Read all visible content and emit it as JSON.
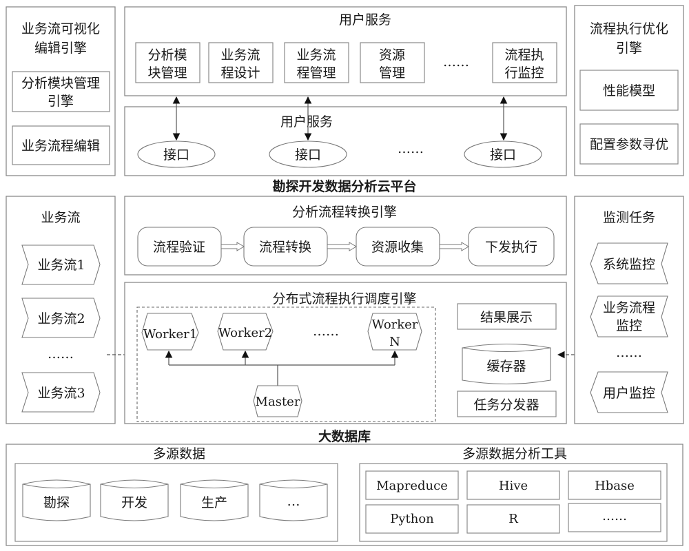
{
  "top_left_panel": {
    "title_line1": "业务流可视化",
    "title_line2": "编辑引擎",
    "item1_line1": "分析模块管理",
    "item1_line2": "引擎",
    "item2": "业务流程编辑"
  },
  "user_service_top": {
    "title": "用户服务",
    "modules": [
      {
        "line1": "分析模",
        "line2": "块管理"
      },
      {
        "line1": "业务流",
        "line2": "程设计"
      },
      {
        "line1": "业务流",
        "line2": "程管理"
      },
      {
        "line1": "资源",
        "line2": "管理"
      },
      {
        "line1": "流程执",
        "line2": "行监控"
      }
    ],
    "ellipsis": "……"
  },
  "user_service_bottom": {
    "title": "用户服务",
    "interfaces": [
      "接口",
      "接口",
      "接口"
    ],
    "ellipsis": "……"
  },
  "top_right_panel": {
    "title_line1": "流程执行优化",
    "title_line2": "引擎",
    "item1": "性能模型",
    "item2": "配置参数寻优"
  },
  "platform_title": "勘探开发数据分析云平台",
  "business_flow_panel": {
    "title": "业务流",
    "items": [
      "业务流1",
      "业务流2",
      "业务流3"
    ],
    "ellipsis": "……"
  },
  "conversion_engine": {
    "title": "分析流程转换引擎",
    "steps": [
      "流程验证",
      "流程转换",
      "资源收集",
      "下发执行"
    ]
  },
  "scheduling_engine": {
    "title": "分布式流程执行调度引擎",
    "workers": [
      "Worker1",
      "Worker2"
    ],
    "worker_n_line1": "Worker",
    "worker_n_line2": "N",
    "ellipsis": "……",
    "master": "Master",
    "result_display": "结果展示",
    "cache": "缓存器",
    "dispatcher": "任务分发器"
  },
  "monitoring_panel": {
    "title": "监测任务",
    "item1": "系统监控",
    "item2_line1": "业务流程",
    "item2_line2": "监控",
    "item3": "用户监控",
    "ellipsis": "……"
  },
  "database_title": "大数据库",
  "multi_source_data": {
    "title": "多源数据",
    "items": [
      "勘探",
      "开发",
      "生产",
      "…"
    ]
  },
  "analysis_tools": {
    "title": "多源数据分析工具",
    "items": [
      "Mapreduce",
      "Hive",
      "Hbase",
      "Python",
      "R",
      "……"
    ]
  }
}
